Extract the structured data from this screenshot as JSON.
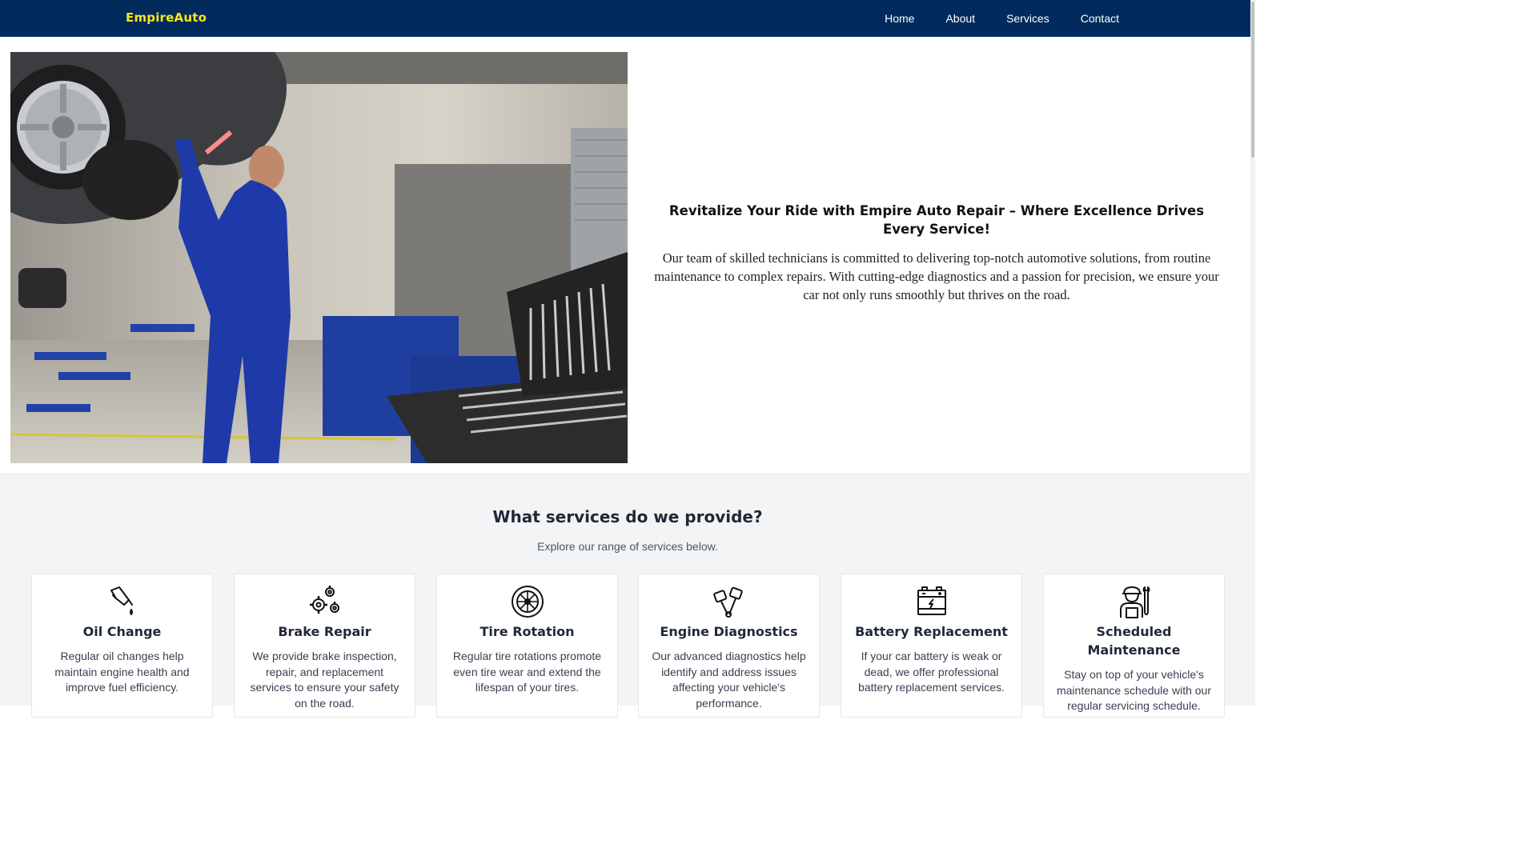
{
  "nav": {
    "brand": "EmpireAuto",
    "links": [
      "Home",
      "About",
      "Services",
      "Contact"
    ],
    "background": "#002b5c",
    "brand_color": "#f6e71a"
  },
  "hero": {
    "image_icon": "mechanic-photo",
    "title": "Revitalize Your Ride with Empire Auto Repair – Where Excellence Drives Every Service!",
    "body": "Our team of skilled technicians is committed to delivering top-notch automotive solutions, from routine maintenance to complex repairs. With cutting-edge diagnostics and a passion for precision, we ensure your car not only runs smoothly but thrives on the road."
  },
  "services": {
    "title": "What services do we provide?",
    "subtitle": "Explore our range of services below.",
    "cards": [
      {
        "icon": "oil-can-icon",
        "title": "Oil Change",
        "desc": "Regular oil changes help maintain engine health and improve fuel efficiency."
      },
      {
        "icon": "gears-icon",
        "title": "Brake Repair",
        "desc": "We provide brake inspection, repair, and replacement services to ensure your safety on the road."
      },
      {
        "icon": "tire-icon",
        "title": "Tire Rotation",
        "desc": "Regular tire rotations promote even tire wear and extend the lifespan of your tires."
      },
      {
        "icon": "pistons-icon",
        "title": "Engine Diagnostics",
        "desc": "Our advanced diagnostics help identify and address issues affecting your vehicle's performance."
      },
      {
        "icon": "battery-icon",
        "title": "Battery Replacement",
        "desc": "If your car battery is weak or dead, we offer professional battery replacement services."
      },
      {
        "icon": "mechanic-icon",
        "title": "Scheduled Maintenance",
        "desc": "Stay on top of your vehicle's maintenance schedule with our regular servicing schedule."
      }
    ]
  }
}
